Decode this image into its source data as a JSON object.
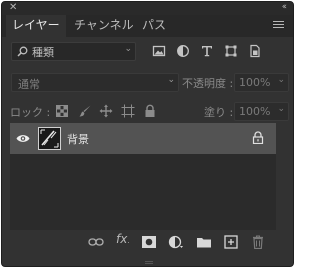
{
  "panel": {
    "tabs": [
      {
        "label": "レイヤー",
        "active": true
      },
      {
        "label": "チャンネル",
        "active": false
      },
      {
        "label": "パス",
        "active": false
      }
    ]
  },
  "filter": {
    "kind_label": "種類",
    "icons": [
      "pixel-filter-icon",
      "adjustment-filter-icon",
      "type-filter-icon",
      "shape-filter-icon",
      "smartobject-filter-icon"
    ]
  },
  "blend": {
    "mode": "通常",
    "opacity_label": "不透明度 :",
    "opacity_value": "100%"
  },
  "lock": {
    "label": "ロック :",
    "fill_label": "塗り :",
    "fill_value": "100%"
  },
  "layers": [
    {
      "name": "背景",
      "visible": true,
      "locked": true
    }
  ],
  "colors": {
    "panel_bg": "#323232",
    "selected_layer": "#535353",
    "tab_bar": "#282828"
  }
}
